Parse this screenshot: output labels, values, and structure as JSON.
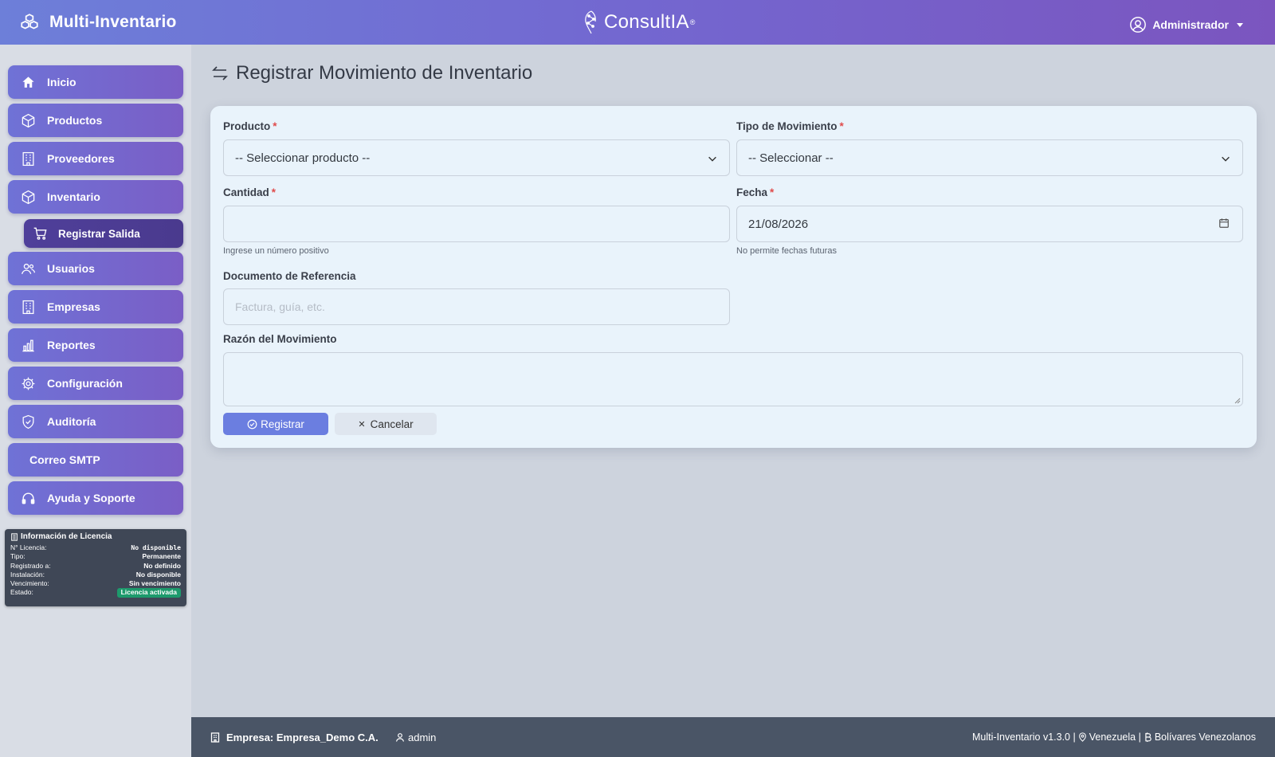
{
  "header": {
    "app_name": "Multi-Inventario",
    "center_logo": "ConsultIA",
    "center_logo_mark": "®",
    "user_label": "Administrador"
  },
  "sidebar": {
    "items": [
      {
        "label": "Inicio",
        "icon": "home-icon"
      },
      {
        "label": "Productos",
        "icon": "box-icon"
      },
      {
        "label": "Proveedores",
        "icon": "building-icon"
      },
      {
        "label": "Inventario",
        "icon": "box-icon"
      },
      {
        "label": "Registrar Salida",
        "icon": "cart-icon"
      },
      {
        "label": "Usuarios",
        "icon": "users-icon"
      },
      {
        "label": "Empresas",
        "icon": "building-icon"
      },
      {
        "label": "Reportes",
        "icon": "bar-chart-icon"
      },
      {
        "label": "Configuración",
        "icon": "gear-icon"
      },
      {
        "label": "Auditoría",
        "icon": "shield-check-icon"
      },
      {
        "label": "Correo SMTP"
      },
      {
        "label": "Ayuda y Soporte",
        "icon": "headset-icon"
      }
    ],
    "license": {
      "title": "Información de Licencia",
      "rows": [
        {
          "k": "N° Licencia:",
          "v": "No disponible"
        },
        {
          "k": "Tipo:",
          "v": "Permanente"
        },
        {
          "k": "Registrado a:",
          "v": "No definido"
        },
        {
          "k": "Instalación:",
          "v": "No disponible"
        },
        {
          "k": "Vencimiento:",
          "v": "Sin vencimiento"
        },
        {
          "k": "Estado:",
          "v": "Licencia activada"
        }
      ]
    }
  },
  "main": {
    "title": "Registrar Movimiento de Inventario",
    "form": {
      "producto_label": "Producto",
      "producto_value": "-- Seleccionar producto --",
      "tipo_label": "Tipo de Movimiento",
      "tipo_value": "-- Seleccionar --",
      "cantidad_label": "Cantidad",
      "cantidad_value": "",
      "cantidad_hint": "Ingrese un número positivo",
      "fecha_label": "Fecha",
      "fecha_value": "21/08/2026",
      "fecha_hint": "No permite fechas futuras",
      "documento_label": "Documento de Referencia",
      "documento_placeholder": "Factura, guía, etc.",
      "razon_label": "Razón del Movimiento",
      "required_mark": "*",
      "submit_label": "Registrar",
      "cancel_label": "Cancelar"
    }
  },
  "footer": {
    "company": "Empresa: Empresa_Demo C.A.",
    "user": "admin",
    "version": "Multi-Inventario v1.3.0 |",
    "country": "Venezuela |",
    "currency": "Bolívares Venezolanos"
  },
  "colors": {
    "accent": "#6b7ee0",
    "header_start": "#6d7fd9",
    "header_end": "#7b55bf",
    "sidebar_active": "#4f3f9a",
    "license_ok": "#1d9a6c",
    "required": "#e04b4b"
  }
}
